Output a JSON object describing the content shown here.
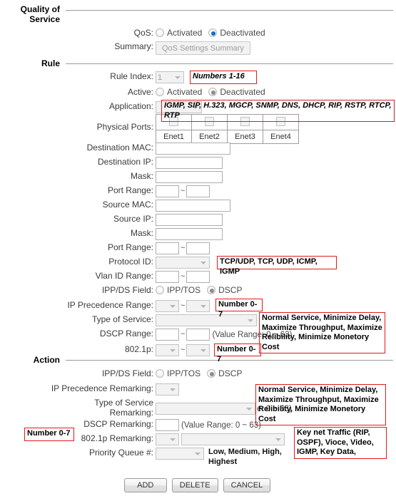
{
  "page": {
    "sections": {
      "qos_title": "Quality of\nService",
      "rule_title": "Rule",
      "action_title": "Action"
    }
  },
  "qos": {
    "qos_label": "QoS:",
    "activated_label": "Activated",
    "deactivated_label": "Deactivated",
    "summary_label": "Summary:",
    "summary_button": "QoS Settings Summary"
  },
  "rule": {
    "rule_index_label": "Rule Index:",
    "rule_index_value": "1",
    "rule_index_note": "Numbers 1-16",
    "active_label": "Active:",
    "active_activated": "Activated",
    "active_deactivated": "Deactivated",
    "application_label": "Application:",
    "application_value": "",
    "application_note": "IGMP, SIP, H.323, MGCP, SNMP, DNS, DHCP, RIP, RSTP, RTCP, RTP",
    "physical_ports_label": "Physical Ports:",
    "ports": [
      "Enet1",
      "Enet2",
      "Enet3",
      "Enet4"
    ],
    "dest_mac_label": "Destination MAC:",
    "dest_mac_value": "",
    "dest_ip_label": "Destination IP:",
    "dest_ip_value": "",
    "dest_mask_label": "Mask:",
    "dest_mask_value": "",
    "dest_port_range_label": "Port Range:",
    "dest_port_from": "",
    "dest_port_to": "",
    "src_mac_label": "Source MAC:",
    "src_mac_value": "",
    "src_ip_label": "Source IP:",
    "src_ip_value": "",
    "src_mask_label": "Mask:",
    "src_mask_value": "",
    "src_port_range_label": "Port Range:",
    "src_port_from": "",
    "src_port_to": "",
    "protocol_id_label": "Protocol ID:",
    "protocol_id_value": "",
    "protocol_id_note": "TCP/UDP, TCP, UDP, ICMP, IGMP",
    "vlan_id_range_label": "Vlan ID Range:",
    "vlan_from": "",
    "vlan_to": "",
    "ipp_ds_label": "IPP/DS Field:",
    "ipp_tos_label": "IPP/TOS",
    "dscp_label": "DSCP",
    "ip_prec_range_label": "IP Precedence Range:",
    "ip_prec_from": "",
    "ip_prec_to": "",
    "ip_prec_note": "Number 0-7",
    "tos_label": "Type of Service:",
    "tos_value": "",
    "tos_note": "Normal Service, Minimize Delay, Maximize Throughput, Maximize Relibility, Minimize Monetory Cost",
    "dscp_range_label": "DSCP Range:",
    "dscp_from": "",
    "dscp_to": "",
    "dscp_value_range": "(Value Range: 0 ~ 63)",
    "dot1p_label": "802.1p:",
    "dot1p_from": "",
    "dot1p_to": "",
    "dot1p_note": "Number 0-7"
  },
  "action": {
    "ipp_ds_label": "IPP/DS Field:",
    "ipp_tos_label": "IPP/TOS",
    "dscp_label": "DSCP",
    "ip_prec_remark_label": "IP Precedence Remarking:",
    "ip_prec_remark_value": "",
    "tos_remark_label": "Type of Service\nRemarking:",
    "tos_remark_value": "",
    "tos_remark_note": "Normal Service, Minimize Delay, Maximize Throughput, Maximize Relibility, Minimize Monetory Cost",
    "tos_remark_value_range": "e: 0 ~ 63)",
    "dscp_remark_label": "DSCP Remarking:",
    "dscp_remark_value": "",
    "dscp_remark_value_range": "(Value Range: 0 ~ 63)",
    "dot1p_remark_label": "802.1p Remarking:",
    "dot1p_remark_num": "",
    "dot1p_remark_value": "",
    "dot1p_remark_note_left": "Number 0-7",
    "dot1p_remark_note_right": "Key net Traffic (RIP, OSPF), Vioce, Video, IGMP, Key Data,",
    "priority_queue_label": "Priority Queue #:",
    "priority_queue_value": "",
    "priority_queue_note": "Low, Medium, High, Highest"
  },
  "buttons": {
    "add": "ADD",
    "delete": "DELETE",
    "cancel": "CANCEL"
  }
}
